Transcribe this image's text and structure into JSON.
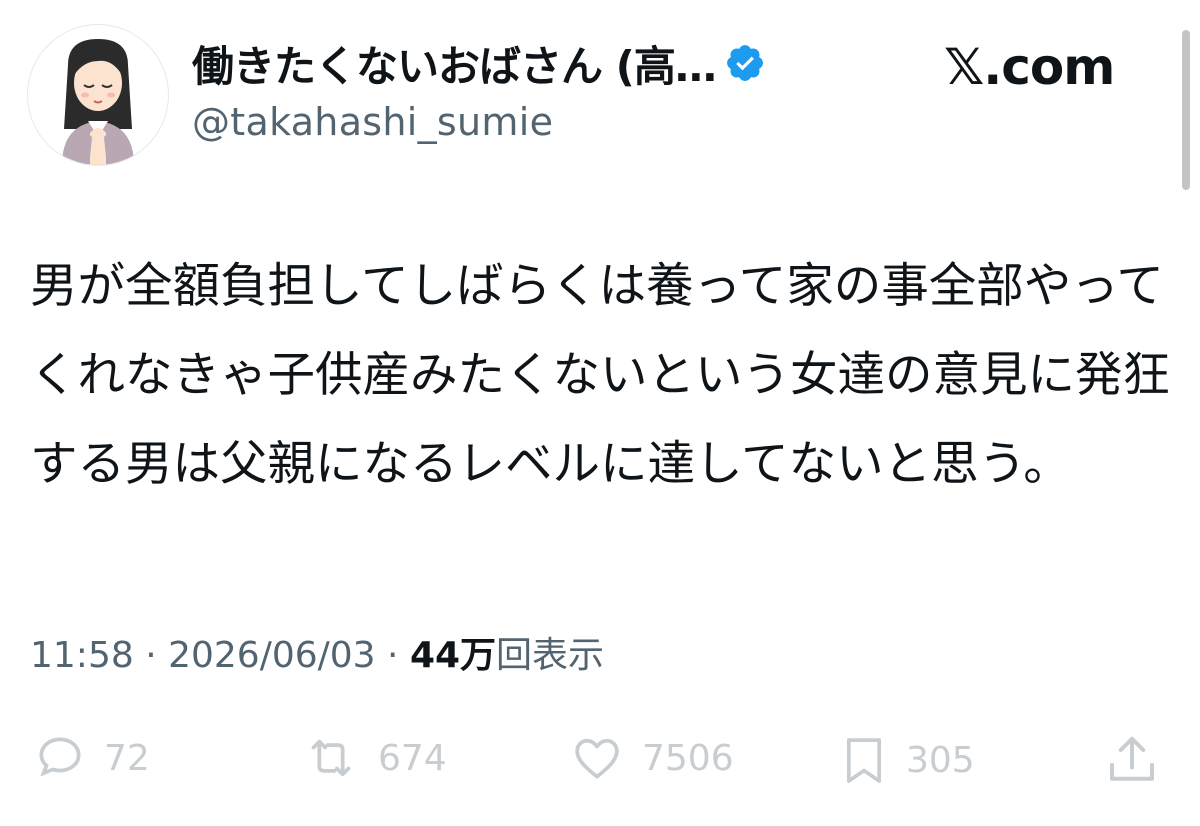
{
  "author": {
    "display_name": "働きたくないおばさん (高…",
    "handle": "@takahashi_sumie",
    "verified": true,
    "avatar_icon": "woman-praying-avatar"
  },
  "site_logo": "𝕏.com",
  "tweet": {
    "text": "男が全額負担してしばらくは養って家の事全部やってくれなきゃ子供産みたくないという女達の意見に発狂する男は父親になるレベルに達してないと思う。"
  },
  "meta": {
    "time": "11:58",
    "separator": " · ",
    "date": "2026/06/03",
    "views_number": "44万",
    "views_label": "回表示"
  },
  "actions": {
    "replies": "72",
    "reposts": "674",
    "likes": "7506",
    "bookmarks": "305"
  },
  "colors": {
    "text": "#0f1419",
    "secondary": "#536471",
    "verified": "#1d9bf0",
    "faded_icons": "#c8cdd1"
  }
}
